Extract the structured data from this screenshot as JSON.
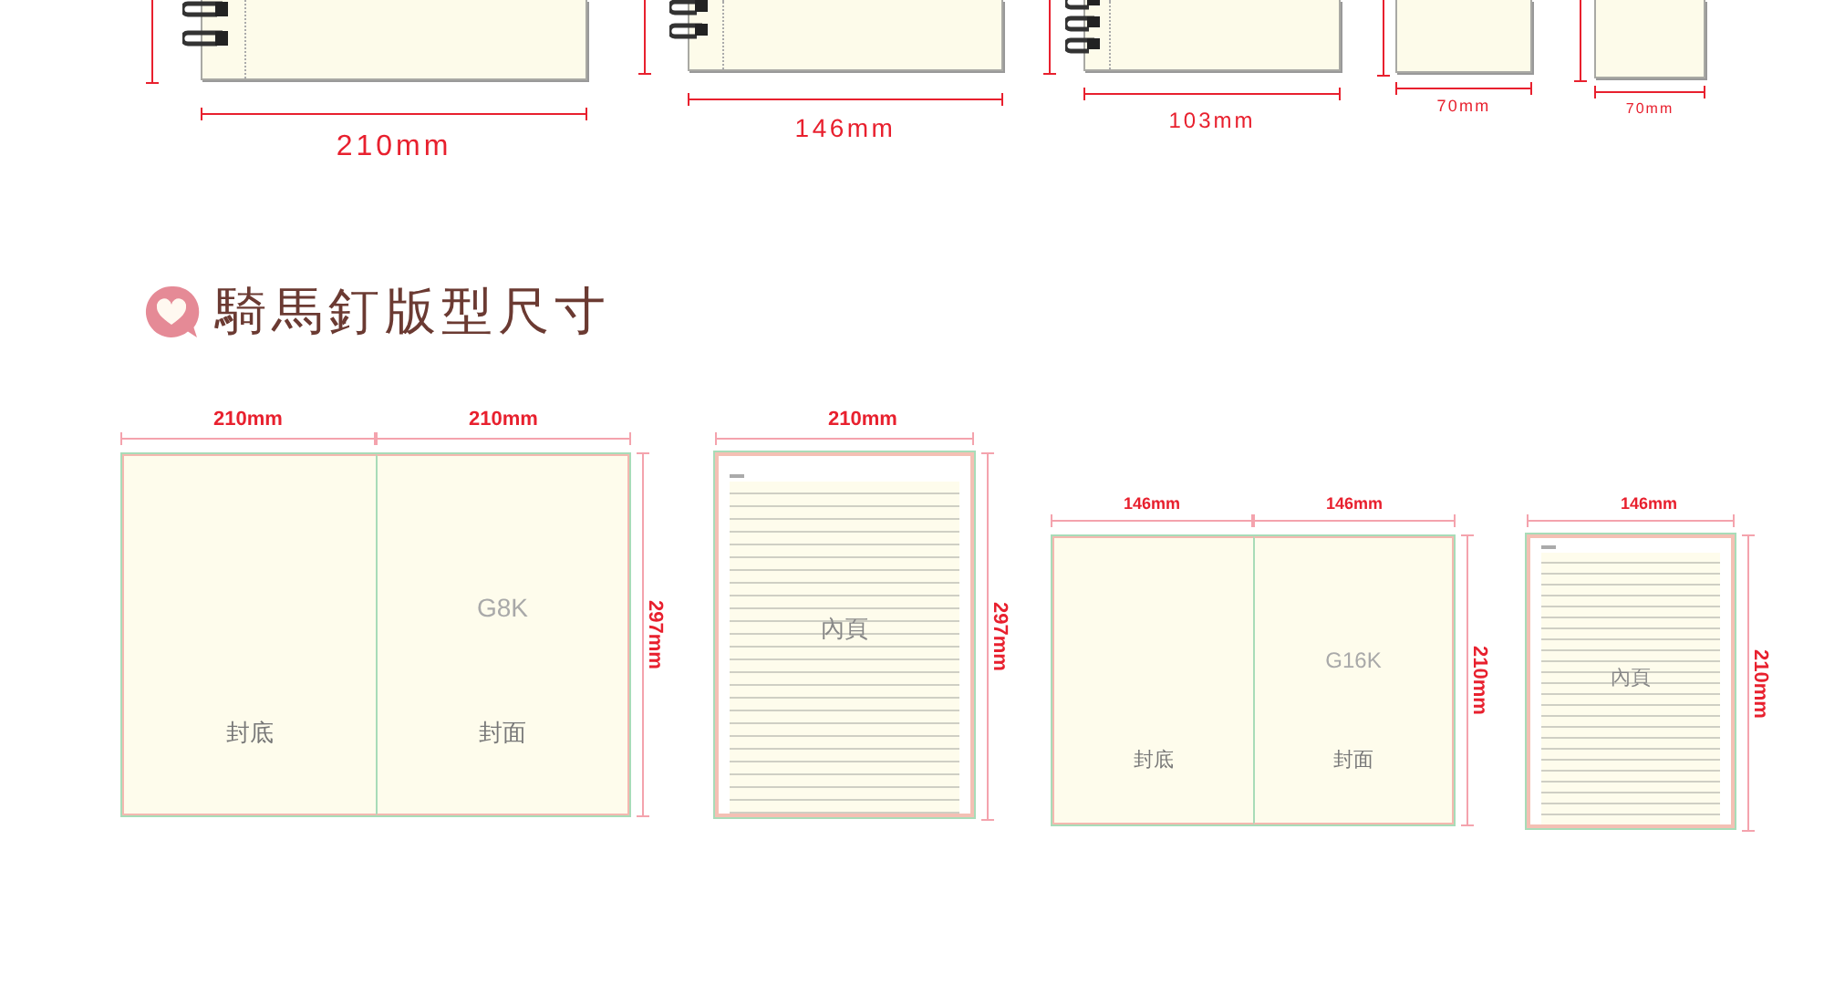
{
  "top_notebooks": [
    {
      "kind": "spiral",
      "width_label": "210mm"
    },
    {
      "kind": "spiral",
      "width_label": "146mm"
    },
    {
      "kind": "spiral",
      "width_label": "103mm"
    },
    {
      "kind": "plain",
      "width_label": "70mm"
    },
    {
      "kind": "plain",
      "width_label": "70mm"
    }
  ],
  "section": {
    "title": "騎馬釘版型尺寸"
  },
  "layouts": [
    {
      "kind": "spread",
      "width_labels": [
        "210mm",
        "210mm"
      ],
      "height_label": "297mm",
      "size_label": "G8K",
      "back_label": "封底",
      "front_label": "封面"
    },
    {
      "kind": "inner",
      "width_label": "210mm",
      "height_label": "297mm",
      "page_label": "內頁"
    },
    {
      "kind": "spread",
      "width_labels": [
        "146mm",
        "146mm"
      ],
      "height_label": "210mm",
      "size_label": "G16K",
      "back_label": "封底",
      "front_label": "封面"
    },
    {
      "kind": "inner",
      "width_label": "146mm",
      "height_label": "210mm",
      "page_label": "內頁"
    }
  ]
}
